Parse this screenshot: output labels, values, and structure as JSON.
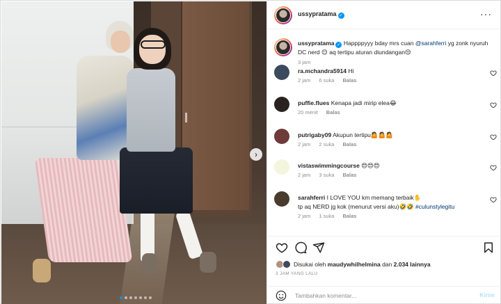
{
  "post": {
    "username": "ussypratama",
    "verified_icon": "verified-badge-icon",
    "more_icon": "more-options-icon",
    "carousel_dot_count": 7,
    "carousel_active_index": 0,
    "next_icon": "chevron-right-icon"
  },
  "caption": {
    "username": "ussypratama",
    "text_before": "Happppyyy bday mrs cuan ",
    "mention": "@sarahferri",
    "text_after": " yg zonk nyuruh DC nerd 😊 aq tertipu aturan diundangan😒",
    "time": "3 jam"
  },
  "comments": [
    {
      "username": "ra.mchandra5914",
      "text": "Hi",
      "time": "2 jam",
      "likes": "6 suka",
      "reply": "Balas",
      "avatar_color": "#3b4a5c"
    },
    {
      "username": "puffie.flues",
      "text": "Kenapa jadi mirip elea😂",
      "time": "20 menit",
      "likes": "",
      "reply": "Balas",
      "avatar_color": "#2a2220"
    },
    {
      "username": "putrigaby09",
      "text": "Akupun tertipu🤷🤷🤷",
      "time": "2 jam",
      "likes": "2 suka",
      "reply": "Balas",
      "avatar_color": "#6e3a3a"
    },
    {
      "username": "vistaswimmingcourse",
      "text": "😍😍😍",
      "time": "2 jam",
      "likes": "3 suka",
      "reply": "Balas",
      "avatar_color": "#f3f6dc"
    },
    {
      "username": "sarahferri",
      "text": "I LOVE YOU km memang terbaik✋",
      "text2_before": "tp aq NERD jg kok (menurut versi aku)🤣🤣 ",
      "text2_tag": "#culunstylegitu",
      "time": "2 jam",
      "likes": "1 suka",
      "reply": "Balas",
      "avatar_color": "#4a3b2f"
    }
  ],
  "actions": {
    "like_icon": "heart-icon",
    "comment_icon": "comment-icon",
    "share_icon": "share-icon",
    "save_icon": "bookmark-icon"
  },
  "likes": {
    "prefix": "Disukai oleh ",
    "user": "maudywhilhelmina",
    "middle": " dan ",
    "count": "2.034 lainnya"
  },
  "posted_ago": "3 JAM YANG LALU",
  "comment_box": {
    "placeholder": "Tambahkan komentar...",
    "post_label": "Kirim",
    "emoji_icon": "emoji-smile-icon"
  }
}
